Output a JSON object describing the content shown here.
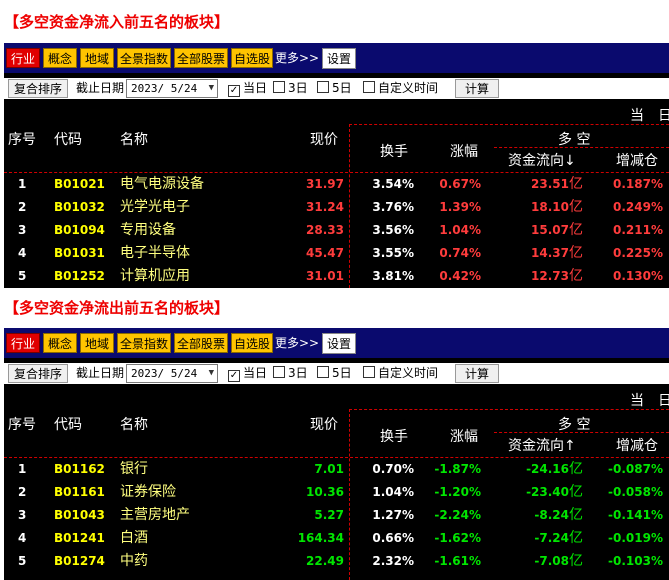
{
  "sections": [
    {
      "title": "【多空资金净流入前五名的板块】",
      "tabs": [
        "行业",
        "概念",
        "地域",
        "全景指数",
        "全部股票",
        "自选股"
      ],
      "more_label": "更多>>",
      "settings_label": "设置",
      "toolbar": {
        "sort_label": "复合排序",
        "date_label": "截止日期",
        "date_value": "2023/ 5/24",
        "options": [
          {
            "label": "当日",
            "checked": true
          },
          {
            "label": "3日",
            "checked": false
          },
          {
            "label": "5日",
            "checked": false
          },
          {
            "label": "自定义时间",
            "checked": false
          }
        ],
        "calc_label": "计算"
      },
      "header": {
        "period": "当",
        "period2": "日",
        "idx": "序号",
        "code": "代码",
        "name": "名称",
        "price": "现价",
        "turnover": "换手",
        "change": "涨幅",
        "group": "多 空",
        "flow": "资金流向↓",
        "rate": "增减仓"
      },
      "rows": [
        {
          "idx": "1",
          "code": "B01021",
          "name": "电气电源设备",
          "price": "31.97",
          "turnover": "3.54%",
          "change": "0.67%",
          "flow": "23.51",
          "unit": "亿",
          "rate": "0.187%"
        },
        {
          "idx": "2",
          "code": "B01032",
          "name": "光学光电子",
          "price": "31.24",
          "turnover": "3.76%",
          "change": "1.39%",
          "flow": "18.10",
          "unit": "亿",
          "rate": "0.249%"
        },
        {
          "idx": "3",
          "code": "B01094",
          "name": "专用设备",
          "price": "28.33",
          "turnover": "3.56%",
          "change": "1.04%",
          "flow": "15.07",
          "unit": "亿",
          "rate": "0.211%"
        },
        {
          "idx": "4",
          "code": "B01031",
          "name": "电子半导体",
          "price": "45.47",
          "turnover": "3.55%",
          "change": "0.74%",
          "flow": "14.37",
          "unit": "亿",
          "rate": "0.225%"
        },
        {
          "idx": "5",
          "code": "B01252",
          "name": "计算机应用",
          "price": "31.01",
          "turnover": "3.81%",
          "change": "0.42%",
          "flow": "12.73",
          "unit": "亿",
          "rate": "0.130%"
        }
      ]
    },
    {
      "title": "【多空资金净流出前五名的板块】",
      "tabs": [
        "行业",
        "概念",
        "地域",
        "全景指数",
        "全部股票",
        "自选股"
      ],
      "more_label": "更多>>",
      "settings_label": "设置",
      "toolbar": {
        "sort_label": "复合排序",
        "date_label": "截止日期",
        "date_value": "2023/ 5/24",
        "options": [
          {
            "label": "当日",
            "checked": true
          },
          {
            "label": "3日",
            "checked": false
          },
          {
            "label": "5日",
            "checked": false
          },
          {
            "label": "自定义时间",
            "checked": false
          }
        ],
        "calc_label": "计算"
      },
      "header": {
        "period": "当",
        "period2": "日",
        "idx": "序号",
        "code": "代码",
        "name": "名称",
        "price": "现价",
        "turnover": "换手",
        "change": "涨幅",
        "group": "多 空",
        "flow": "资金流向↑",
        "rate": "增减仓"
      },
      "rows": [
        {
          "idx": "1",
          "code": "B01162",
          "name": "银行",
          "price": "7.01",
          "turnover": "0.70%",
          "change": "-1.87%",
          "flow": "-24.16",
          "unit": "亿",
          "rate": "-0.087%"
        },
        {
          "idx": "2",
          "code": "B01161",
          "name": "证券保险",
          "price": "10.36",
          "turnover": "1.04%",
          "change": "-1.20%",
          "flow": "-23.40",
          "unit": "亿",
          "rate": "-0.058%"
        },
        {
          "idx": "3",
          "code": "B01043",
          "name": "主营房地产",
          "price": "5.27",
          "turnover": "1.27%",
          "change": "-2.24%",
          "flow": "-8.24",
          "unit": "亿",
          "rate": "-0.141%"
        },
        {
          "idx": "4",
          "code": "B01241",
          "name": "白酒",
          "price": "164.34",
          "turnover": "0.66%",
          "change": "-1.62%",
          "flow": "-7.24",
          "unit": "亿",
          "rate": "-0.019%"
        },
        {
          "idx": "5",
          "code": "B01274",
          "name": "中药",
          "price": "22.49",
          "turnover": "2.32%",
          "change": "-1.61%",
          "flow": "-7.08",
          "unit": "亿",
          "rate": "-0.103%"
        }
      ]
    }
  ],
  "colors": {
    "up": "#ff3c3c",
    "down": "#00e600",
    "code": "#ffff00",
    "name": "#ffff80",
    "tab": "#ffc400",
    "tab_active": "#e00000",
    "tabbar": "#0a0a6e",
    "title": "#ee0000"
  }
}
